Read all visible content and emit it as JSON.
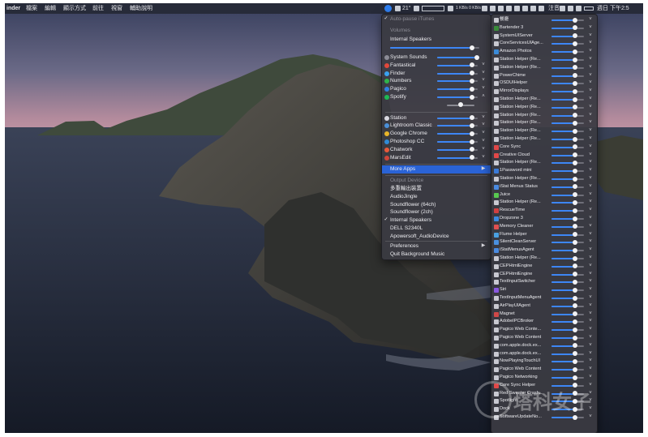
{
  "menubar": {
    "app_name": "inder",
    "items": [
      "檔案",
      "編輯",
      "顯示方式",
      "前往",
      "視窗",
      "輔助說明"
    ],
    "status_left": "21°",
    "status_rates": "1 KB/s 0 KB/s",
    "ime": "注音",
    "clock": "週日 下午2:5"
  },
  "main_menu": {
    "auto_pause": "Auto-pause iTunes",
    "volumes_header": "Volumes",
    "device_name": "Internal Speakers",
    "device_volume": 0.92,
    "apps": [
      {
        "name": "System Sounds",
        "level": 0.98,
        "icon": "system-sounds-icon",
        "color": "#8c8c96",
        "chev": false
      },
      {
        "name": "Fantastical",
        "level": 0.85,
        "icon": "fantastical-icon",
        "color": "#e0483b",
        "chev": true
      },
      {
        "name": "Finder",
        "level": 0.85,
        "icon": "finder-icon",
        "color": "#3aa1f0",
        "chev": true
      },
      {
        "name": "Numbers",
        "level": 0.85,
        "icon": "numbers-icon",
        "color": "#2fb34a",
        "chev": true
      },
      {
        "name": "Pagico",
        "level": 0.85,
        "icon": "pagico-icon",
        "color": "#2f7fe0",
        "chev": true
      },
      {
        "name": "Spotify",
        "level": 0.85,
        "icon": "spotify-icon",
        "color": "#1db954",
        "chev": true,
        "expanded": true
      },
      {
        "name": "Station",
        "level": 0.85,
        "icon": "station-icon",
        "color": "#d8d8e0",
        "chev": true
      },
      {
        "name": "Lightroom Classic",
        "level": 0.85,
        "icon": "lightroom-icon",
        "color": "#4a8fd8",
        "chev": true
      },
      {
        "name": "Google Chrome",
        "level": 0.85,
        "icon": "chrome-icon",
        "color": "#e8b52a",
        "chev": true
      },
      {
        "name": "Photoshop CC",
        "level": 0.85,
        "icon": "photoshop-icon",
        "color": "#2f8bd6",
        "chev": true
      },
      {
        "name": "Chatwork",
        "level": 0.85,
        "icon": "chatwork-icon",
        "color": "#e85a3a",
        "chev": true
      },
      {
        "name": "MarsEdit",
        "level": 0.85,
        "icon": "marsedit-icon",
        "color": "#d0463a",
        "chev": true
      }
    ],
    "spotify_balance": 0.5,
    "more_apps": "More Apps",
    "output_header": "Output Device",
    "outputs": [
      {
        "name": "多重輸出裝置",
        "checked": false
      },
      {
        "name": "AudioJingle",
        "checked": false
      },
      {
        "name": "Soundflower (64ch)",
        "checked": false
      },
      {
        "name": "Soundflower (2ch)",
        "checked": false
      },
      {
        "name": "Internal Speakers",
        "checked": true
      },
      {
        "name": "DELL S2340L",
        "checked": false
      },
      {
        "name": "Apowersoft_AudioDevice",
        "checked": false
      }
    ],
    "preferences": "Preferences",
    "quit": "Quit Background Music"
  },
  "more_menu": {
    "apps": [
      {
        "name": "餐廳",
        "icon": "app-icon",
        "color": "#c8c8d0"
      },
      {
        "name": "Bartender 3",
        "icon": "bartender-icon",
        "color": "#3a8a3a"
      },
      {
        "name": "SystemUIServer",
        "icon": "app-icon",
        "color": "#c8c8d0"
      },
      {
        "name": "CoreServicesUIAge...",
        "icon": "app-icon",
        "color": "#c8c8d0"
      },
      {
        "name": "Amazon Photos",
        "icon": "amazon-photos-icon",
        "color": "#3a8ad8"
      },
      {
        "name": "Station Helper (Re...",
        "icon": "app-icon",
        "color": "#c8c8d0"
      },
      {
        "name": "Station Helper (Re...",
        "icon": "app-icon",
        "color": "#c8c8d0"
      },
      {
        "name": "PowerChime",
        "icon": "app-icon",
        "color": "#c8c8d0"
      },
      {
        "name": "OSDUIHelper",
        "icon": "app-icon",
        "color": "#c8c8d0"
      },
      {
        "name": "MirrorDisplays",
        "icon": "app-icon",
        "color": "#c8c8d0"
      },
      {
        "name": "Station Helper (Re...",
        "icon": "app-icon",
        "color": "#c8c8d0"
      },
      {
        "name": "Station Helper (Re...",
        "icon": "app-icon",
        "color": "#c8c8d0"
      },
      {
        "name": "Station Helper (Re...",
        "icon": "app-icon",
        "color": "#c8c8d0"
      },
      {
        "name": "Station Helper (Re...",
        "icon": "app-icon",
        "color": "#c8c8d0"
      },
      {
        "name": "Station Helper (Re...",
        "icon": "app-icon",
        "color": "#c8c8d0"
      },
      {
        "name": "Station Helper (Re...",
        "icon": "app-icon",
        "color": "#c8c8d0"
      },
      {
        "name": "Core Sync",
        "icon": "core-sync-icon",
        "color": "#e04848"
      },
      {
        "name": "Creative Cloud",
        "icon": "creative-cloud-icon",
        "color": "#e04848"
      },
      {
        "name": "Station Helper (Re...",
        "icon": "app-icon",
        "color": "#c8c8d0"
      },
      {
        "name": "1Password mini",
        "icon": "1password-icon",
        "color": "#3a7ad8"
      },
      {
        "name": "Station Helper (Re...",
        "icon": "app-icon",
        "color": "#c8c8d0"
      },
      {
        "name": "iStat Menus Status",
        "icon": "istat-icon",
        "color": "#4a8ae0"
      },
      {
        "name": "Juice",
        "icon": "juice-icon",
        "color": "#58c850"
      },
      {
        "name": "Station Helper (Re...",
        "icon": "app-icon",
        "color": "#c8c8d0"
      },
      {
        "name": "RescueTime",
        "icon": "rescuetime-icon",
        "color": "#d04040"
      },
      {
        "name": "Dropzone 3",
        "icon": "dropzone-icon",
        "color": "#3a8ae0"
      },
      {
        "name": "Memory Cleaner",
        "icon": "memory-cleaner-icon",
        "color": "#e05050"
      },
      {
        "name": "Flume Helper",
        "icon": "flume-icon",
        "color": "#4aa0e0"
      },
      {
        "name": "SilentCleanServer",
        "icon": "app-icon",
        "color": "#4a90e0"
      },
      {
        "name": "iStatMenusAgent",
        "icon": "istat-icon",
        "color": "#4a8ae0"
      },
      {
        "name": "Station Helper (Re...",
        "icon": "app-icon",
        "color": "#c8c8d0"
      },
      {
        "name": "CEPHtmlEngine",
        "icon": "app-icon",
        "color": "#c8c8d0"
      },
      {
        "name": "CEPHtmlEngine",
        "icon": "app-icon",
        "color": "#c8c8d0"
      },
      {
        "name": "TextInputSwitcher",
        "icon": "app-icon",
        "color": "#c8c8d0"
      },
      {
        "name": "Siri",
        "icon": "siri-icon",
        "color": "#8a58e0"
      },
      {
        "name": "TextInputMenuAgent",
        "icon": "app-icon",
        "color": "#c8c8d0"
      },
      {
        "name": "AirPlayUIAgent",
        "icon": "airplay-icon",
        "color": "#c8c8d0"
      },
      {
        "name": "Magnet",
        "icon": "magnet-icon",
        "color": "#d04848"
      },
      {
        "name": "AdobeIPCBroker",
        "icon": "app-icon",
        "color": "#c8c8d0"
      },
      {
        "name": "Pagico Web Conte...",
        "icon": "app-icon",
        "color": "#c8c8d0"
      },
      {
        "name": "Pagico Web Content",
        "icon": "app-icon",
        "color": "#c8c8d0"
      },
      {
        "name": "com.apple.dock.ex...",
        "icon": "app-icon",
        "color": "#c8c8d0"
      },
      {
        "name": "com.apple.dock.ex...",
        "icon": "app-icon",
        "color": "#c8c8d0"
      },
      {
        "name": "NowPlayingTouchUI",
        "icon": "app-icon",
        "color": "#c8c8d0"
      },
      {
        "name": "Pagico Web Content",
        "icon": "app-icon",
        "color": "#c8c8d0"
      },
      {
        "name": "Pagico Networking",
        "icon": "app-icon",
        "color": "#c8c8d0"
      },
      {
        "name": "Core Sync Helper",
        "icon": "core-sync-icon",
        "color": "#e04848"
      },
      {
        "name": "Red Sweater Crash...",
        "icon": "app-icon",
        "color": "#c8c8d0"
      },
      {
        "name": "Spotlight",
        "icon": "spotlight-icon",
        "color": "#c8c8d0"
      },
      {
        "name": "Dock",
        "icon": "dock-icon",
        "color": "#c8c8d0"
      },
      {
        "name": "SoftwareUpdateNo...",
        "icon": "app-icon",
        "color": "#c8c8d0"
      }
    ],
    "level": 0.72
  },
  "watermark": "塔科女子"
}
